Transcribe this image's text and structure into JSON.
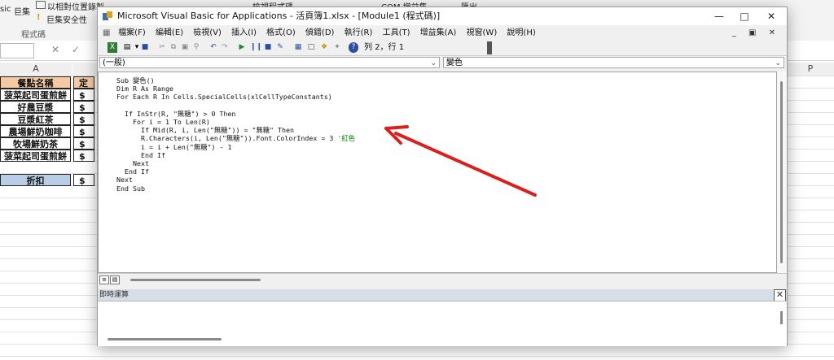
{
  "excel": {
    "ribbon": {
      "macro_label_left": "sic",
      "macro_label": "巨集",
      "relative_ref": "以相對位置錄製",
      "macro_security": "巨集安全性",
      "group_label": "程式碼",
      "view_code": "檢視程式碼",
      "com_addins": "COM 增益集",
      "export": "匯出"
    },
    "formula_bar": {
      "cancel_icon": "✕",
      "enter_icon": "✓"
    },
    "columns": [
      {
        "label": "A"
      },
      {
        "label": ""
      },
      {
        "label": ""
      },
      {
        "label": "P"
      }
    ],
    "rows": [
      {
        "name": "餐點名稱",
        "col2": "定",
        "style": "hdr"
      },
      {
        "name": "菠菜起司蛋煎餅",
        "col2": "$",
        "style": ""
      },
      {
        "name": "好農豆漿",
        "col2": "$",
        "style": ""
      },
      {
        "name": "豆漿紅茶",
        "col2": "$",
        "style": ""
      },
      {
        "name": "農場鮮奶咖啡",
        "col2": "$",
        "style": ""
      },
      {
        "name": "牧場鮮奶茶",
        "col2": "$",
        "style": ""
      },
      {
        "name": "菠菜起司蛋煎餅",
        "col2": "$",
        "style": ""
      },
      {
        "name": "折扣",
        "col2": "$",
        "style": "disc"
      }
    ]
  },
  "vba": {
    "title": "Microsoft Visual Basic for Applications - 活頁簿1.xlsx - [Module1 (程式碼)]",
    "menu": [
      "檔案(F)",
      "編輯(E)",
      "檢視(V)",
      "插入(I)",
      "格式(O)",
      "偵錯(D)",
      "執行(R)",
      "工具(T)",
      "增益集(A)",
      "視窗(W)",
      "說明(H)"
    ],
    "position": "列 2，行 1",
    "object_combo": "(一般)",
    "proc_combo": "變色",
    "code_lines": [
      "Sub 變色()",
      "Dim R As Range",
      "For Each R In Cells.SpecialCells(xlCellTypeConstants)",
      "",
      "  If InStr(R, \"無糖\") > 0 Then",
      "    For i = 1 To Len(R)",
      "      If Mid(R, i, Len(\"無糖\")) = \"無糖\" Then",
      "      R.Characters(i, Len(\"無糖\")).Font.ColorIndex = 3 ",
      "      i = i + Len(\"無糖\") - 1",
      "      End If",
      "    Next",
      "  End If",
      "Next",
      "End Sub"
    ],
    "comment": "'紅色",
    "immediate_label": "即時運算",
    "colors": {
      "comment": "#008000",
      "arrow": "#d9201e",
      "title_bg": "#ffffff",
      "immediate_header": "#d6dfe8"
    }
  }
}
